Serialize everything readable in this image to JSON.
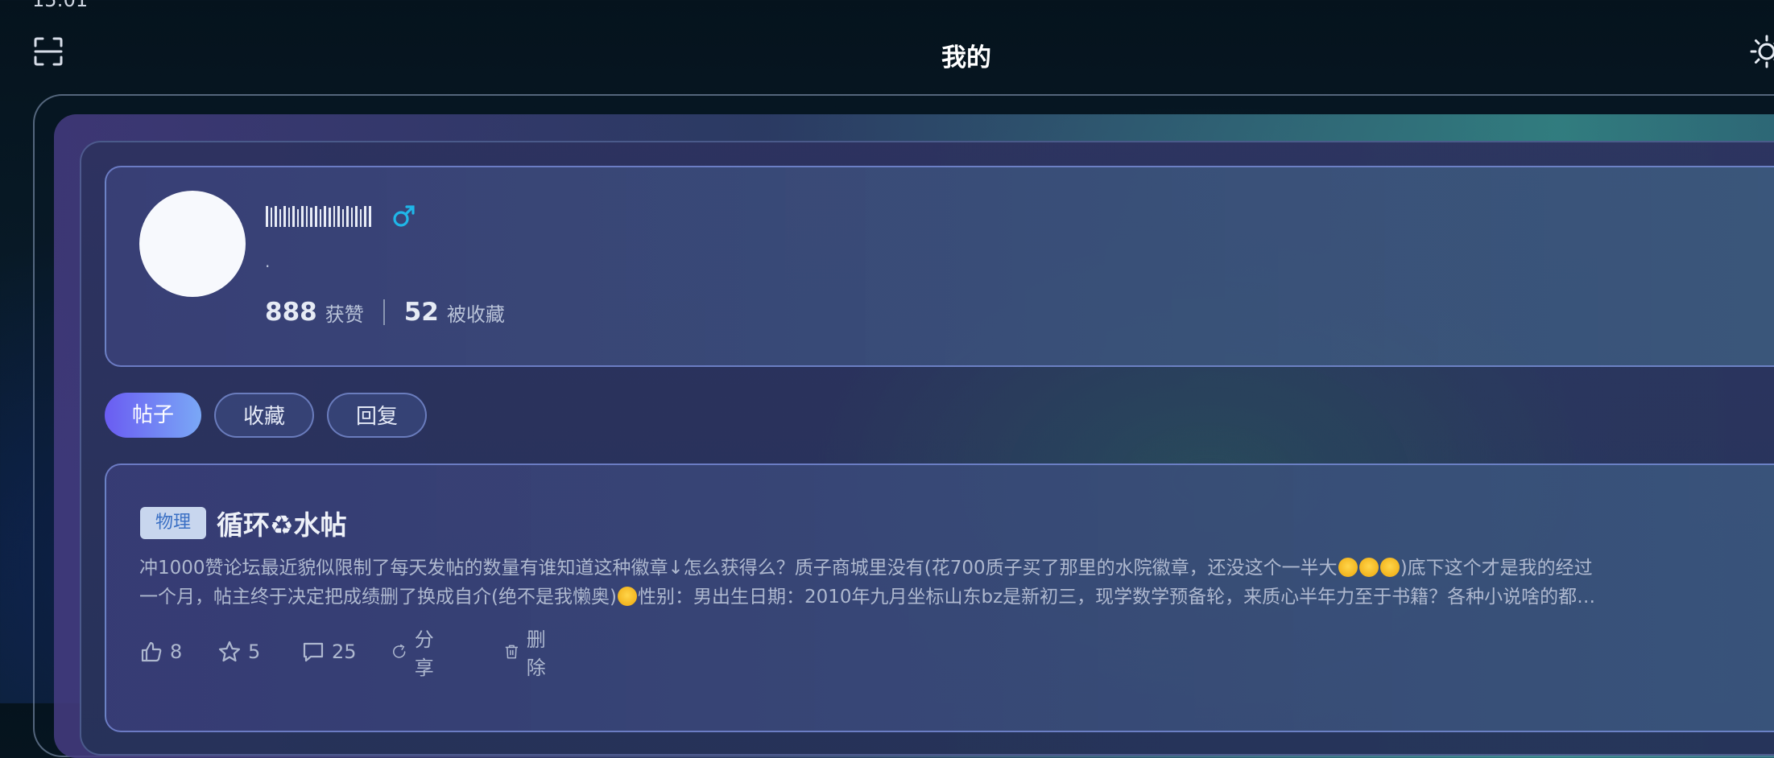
{
  "status_bar": {
    "time": "15:01"
  },
  "header": {
    "title": "我的",
    "scan_icon": "scan-icon",
    "theme_icon": "sun-icon"
  },
  "profile": {
    "username": "|||||||||||||||||||",
    "gender_symbol": "♂",
    "gender_color": "#1fb6e8",
    "bio": ".",
    "likes_count": "888",
    "likes_label": "获赞",
    "favorites_count": "52",
    "favorites_label": "被收藏"
  },
  "tabs": [
    {
      "label": "帖子",
      "active": true
    },
    {
      "label": "收藏",
      "active": false
    },
    {
      "label": "回复",
      "active": false
    }
  ],
  "post": {
    "tag": "物理",
    "title_part1": "循环",
    "title_part2": "水帖",
    "body_line1_a": "冲1000赞论坛最近貌似限制了每天发帖的数量有谁知道这种徽章↓怎么获得么？质子商城里没有(花700质子买了那里的水院徽章，还没这个一半大",
    "body_line1_b": ")底下这个才是我的经过",
    "body_line2_a": "一个月，帖主终于决定把成绩删了换成自介(绝不是我懒奥)",
    "body_line2_b": "性别：男出生日期：2010年九月坐标山东bz是新初三，现学数学预备轮，来质心半年力至于书籍？各种小说啥的都…",
    "likes": "8",
    "stars": "5",
    "comments": "25",
    "share_label": "分享",
    "delete_label": "删除"
  },
  "colors": {
    "accent_gradient_start": "#6a5cf2",
    "accent_gradient_end": "#7aa8f6",
    "tag_bg": "#c8d6ee",
    "tag_text": "#3a6fc4"
  }
}
